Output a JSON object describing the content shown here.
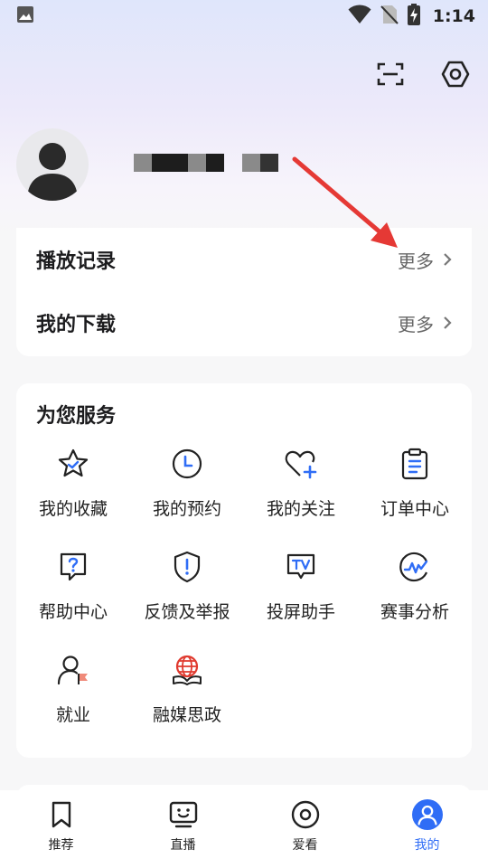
{
  "status_bar": {
    "time": "1:14"
  },
  "profile": {
    "name_redacted": true
  },
  "history_card": {
    "rows": [
      {
        "title": "播放记录",
        "more": "更多"
      },
      {
        "title": "我的下载",
        "more": "更多"
      }
    ]
  },
  "services": {
    "title": "为您服务",
    "items": [
      {
        "label": "我的收藏",
        "icon": "star-badge-icon"
      },
      {
        "label": "我的预约",
        "icon": "clock-icon"
      },
      {
        "label": "我的关注",
        "icon": "heart-plus-icon"
      },
      {
        "label": "订单中心",
        "icon": "clipboard-icon"
      },
      {
        "label": "帮助中心",
        "icon": "help-bubble-icon"
      },
      {
        "label": "反馈及举报",
        "icon": "shield-alert-icon"
      },
      {
        "label": "投屏助手",
        "icon": "tv-cast-icon"
      },
      {
        "label": "赛事分析",
        "icon": "analysis-icon"
      },
      {
        "label": "就业",
        "icon": "person-flag-icon"
      },
      {
        "label": "融媒思政",
        "icon": "globe-book-icon"
      }
    ]
  },
  "tabbar": {
    "tabs": [
      {
        "label": "推荐",
        "icon": "bookmark-icon"
      },
      {
        "label": "直播",
        "icon": "tv-face-icon"
      },
      {
        "label": "爱看",
        "icon": "disc-icon"
      },
      {
        "label": "我的",
        "icon": "profile-icon",
        "active": true
      }
    ]
  },
  "colors": {
    "accent": "#2f6df6",
    "annotation_arrow": "#e53935"
  }
}
